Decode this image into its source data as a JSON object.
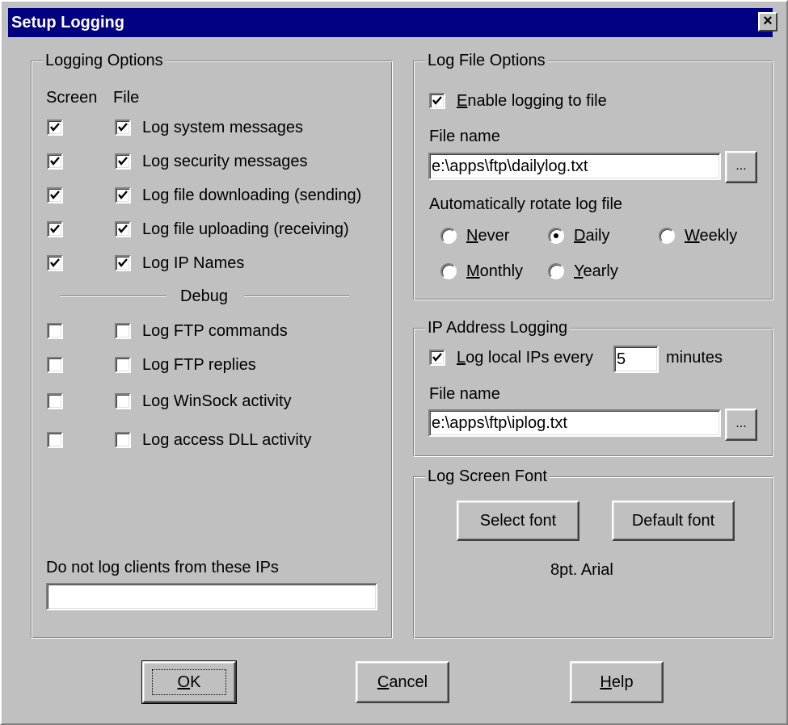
{
  "window": {
    "title": "Setup Logging",
    "close_glyph": "×"
  },
  "logging_options": {
    "title": "Logging Options",
    "col_screen": "Screen",
    "col_file": "File",
    "items": [
      {
        "label": "Log system messages",
        "screen": true,
        "file": true
      },
      {
        "label": "Log security messages",
        "screen": true,
        "file": true
      },
      {
        "label": "Log file downloading (sending)",
        "screen": true,
        "file": true
      },
      {
        "label": "Log file uploading (receiving)",
        "screen": true,
        "file": true
      },
      {
        "label": "Log IP Names",
        "screen": true,
        "file": true
      }
    ],
    "debug_label": "Debug",
    "debug_items": [
      {
        "label": "Log FTP commands",
        "screen": false,
        "file": false
      },
      {
        "label": "Log FTP replies",
        "screen": false,
        "file": false
      },
      {
        "label": "Log WinSock activity",
        "screen": false,
        "file": false
      },
      {
        "label": "Log access DLL activity",
        "screen": false,
        "file": false
      }
    ],
    "exclude_label": "Do not log clients from these IPs",
    "exclude_value": ""
  },
  "log_file_options": {
    "title": "Log File Options",
    "enable_label": "Enable logging to file",
    "enable_mnemonic": "E",
    "enable_rest": "nable logging to file",
    "enable_checked": true,
    "filename_label": "File name",
    "filename_value": "e:\\apps\\ftp\\dailylog.txt",
    "browse_label": "...",
    "rotate_label": "Automatically rotate log file",
    "rotate_options": [
      {
        "label": "Never",
        "mn": "N",
        "rest": "ever",
        "selected": false
      },
      {
        "label": "Daily",
        "mn": "D",
        "rest": "aily",
        "selected": true
      },
      {
        "label": "Weekly",
        "mn": "W",
        "rest": "eekly",
        "selected": false
      },
      {
        "label": "Monthly",
        "mn": "M",
        "rest": "onthly",
        "selected": false
      },
      {
        "label": "Yearly",
        "mn": "Y",
        "rest": "early",
        "selected": false
      }
    ]
  },
  "ip_logging": {
    "title": "IP Address Logging",
    "log_label": "Log local IPs every",
    "log_mnemonic": "L",
    "log_rest": "og local IPs every",
    "log_checked": true,
    "interval": "5",
    "minutes_label": "minutes",
    "filename_label": "File name",
    "filename_value": "e:\\apps\\ftp\\iplog.txt",
    "browse_label": "..."
  },
  "screen_font": {
    "title": "Log Screen Font",
    "select_label": "Select font",
    "default_label": "Default font",
    "current_font": "8pt. Arial"
  },
  "buttons": {
    "ok": "OK",
    "ok_mn": "O",
    "ok_rest": "K",
    "cancel": "Cancel",
    "cancel_mn": "C",
    "cancel_rest": "ancel",
    "help": "Help",
    "help_mn": "H",
    "help_rest": "elp"
  }
}
